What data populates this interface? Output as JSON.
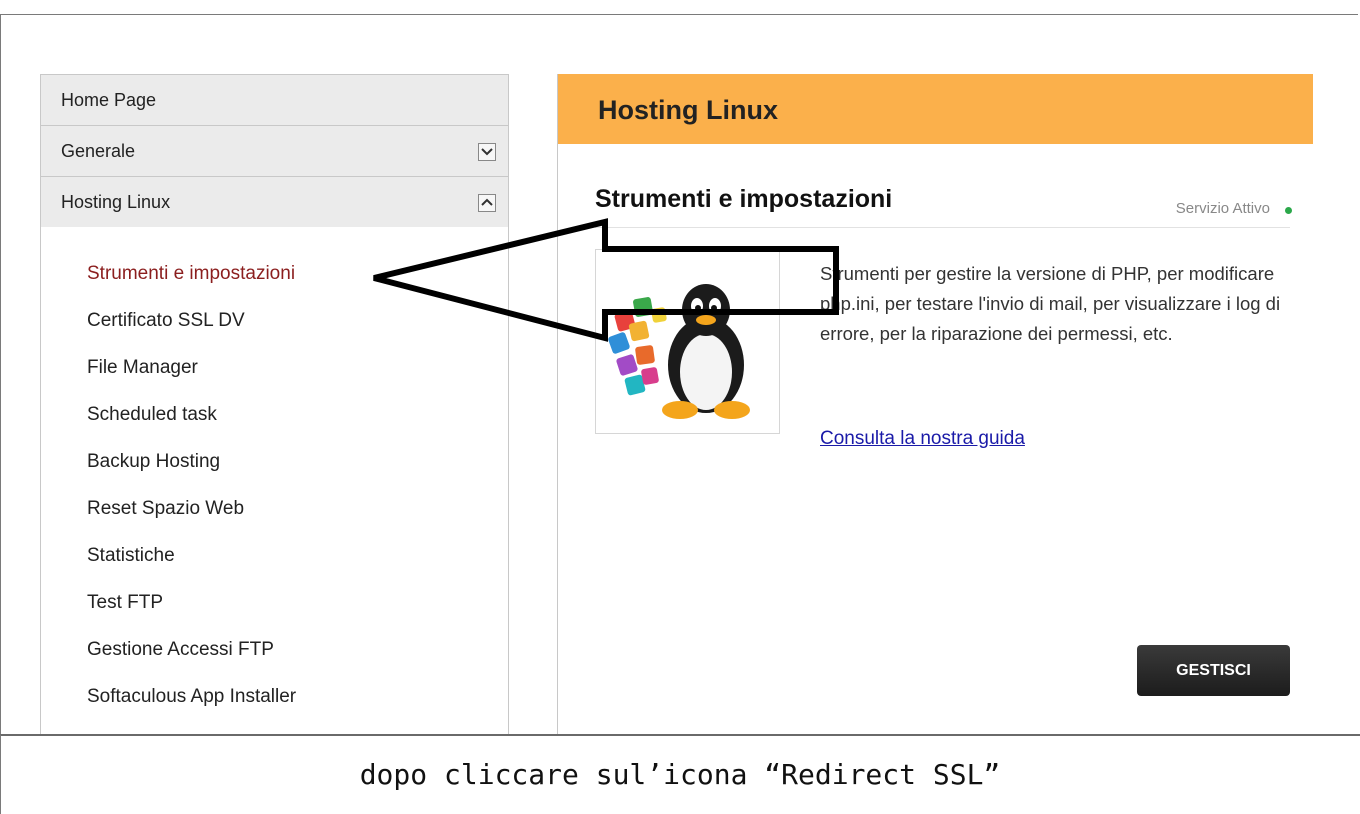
{
  "sidebar": {
    "headers": [
      {
        "label": "Home Page",
        "toggle": null
      },
      {
        "label": "Generale",
        "toggle": "chevron-down-icon"
      },
      {
        "label": "Hosting Linux",
        "toggle": "chevron-up-icon"
      }
    ],
    "items": [
      {
        "label": "Strumenti e impostazioni",
        "active": true
      },
      {
        "label": "Certificato SSL DV",
        "active": false
      },
      {
        "label": "File Manager",
        "active": false
      },
      {
        "label": "Scheduled task",
        "active": false
      },
      {
        "label": "Backup Hosting",
        "active": false
      },
      {
        "label": "Reset Spazio Web",
        "active": false
      },
      {
        "label": "Statistiche",
        "active": false
      },
      {
        "label": "Test FTP",
        "active": false
      },
      {
        "label": "Gestione Accessi FTP",
        "active": false
      },
      {
        "label": "Softaculous App Installer",
        "active": false
      }
    ]
  },
  "main": {
    "header_title": "Hosting Linux",
    "section_title": "Strumenti e impostazioni",
    "status_text": "Servizio Attivo",
    "status_color": "#2ba84a",
    "description": "Strumenti per gestire la versione di PHP, per modificare php.ini, per testare l'invio di mail, per visualizzare i log di errore, per la riparazione dei permessi, etc.",
    "guide_link": "Consulta la nostra guida",
    "manage_button": "GESTISCI",
    "header_color": "#fbb04b",
    "icon": "linux-penguin-icon"
  },
  "annotation": {
    "caption": "dopo cliccare sul’icona “Redirect SSL”",
    "arrow": "arrow-left-icon"
  }
}
